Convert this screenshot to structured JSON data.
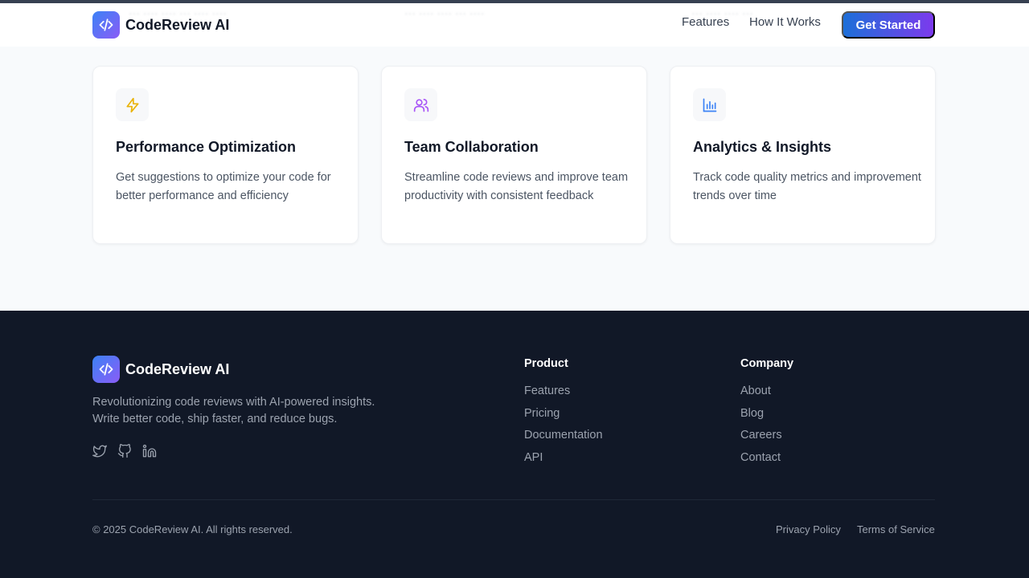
{
  "header": {
    "brand": "CodeReview AI",
    "nav": [
      "Features",
      "How It Works"
    ],
    "cta": "Get Started"
  },
  "features": [
    {
      "icon": "lightning-icon",
      "title": "Performance Optimization",
      "desc": "Get suggestions to optimize your code for better performance and efficiency"
    },
    {
      "icon": "users-icon",
      "title": "Team Collaboration",
      "desc": "Streamline code reviews and improve team productivity with consistent feedback"
    },
    {
      "icon": "bar-chart-icon",
      "title": "Analytics & Insights",
      "desc": "Track code quality metrics and improvement trends over time"
    }
  ],
  "footer": {
    "brand": "CodeReview AI",
    "description": "Revolutionizing code reviews with AI-powered insights. Write better code, ship faster, and reduce bugs.",
    "social_icons": [
      "twitter-icon",
      "github-icon",
      "linkedin-icon"
    ],
    "product": {
      "title": "Product",
      "links": [
        "Features",
        "Pricing",
        "Documentation",
        "API"
      ]
    },
    "company": {
      "title": "Company",
      "links": [
        "About",
        "Blog",
        "Careers",
        "Contact"
      ]
    },
    "copyright": "© 2025 CodeReview AI. All rights reserved.",
    "legal": [
      "Privacy Policy",
      "Terms of Service"
    ]
  },
  "colors": {
    "brand_gradient_start": "#3b82f6",
    "brand_gradient_end": "#8b5cf6",
    "cta_start": "#1d6fd8",
    "cta_end": "#7c3aed",
    "footer_bg": "#111827",
    "lightning": "#eab308",
    "users": "#a855f7",
    "chart": "#3b82f6"
  }
}
